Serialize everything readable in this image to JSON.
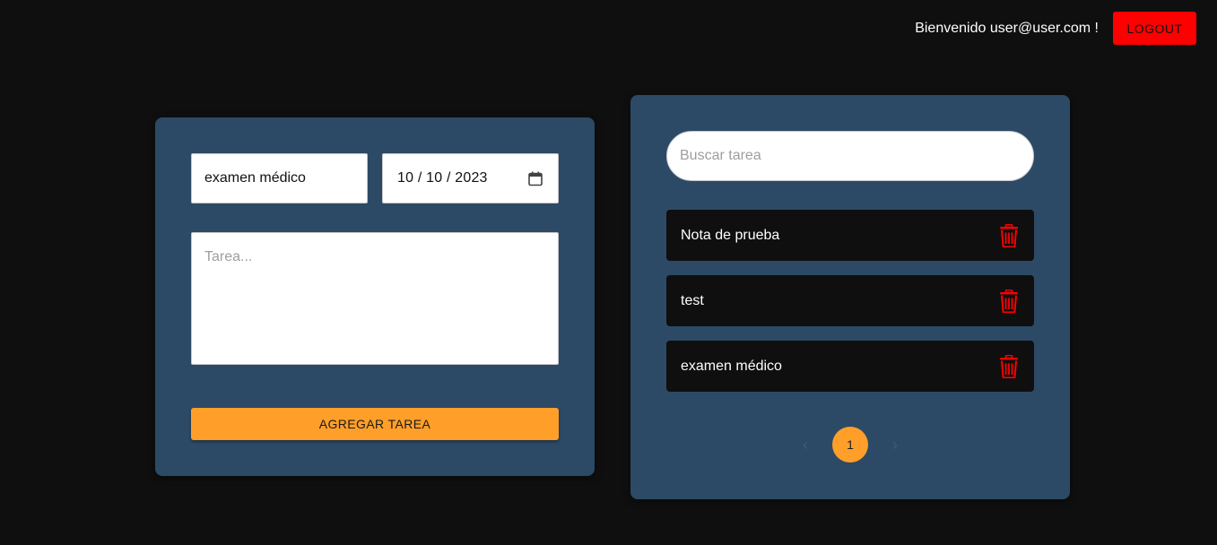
{
  "header": {
    "welcome_text": "Bienvenido user@user.com !",
    "logout_label": "LOGOUT"
  },
  "form": {
    "title_value": "examen médico",
    "date_value": "10 / 10 / 2023",
    "task_placeholder": "Tarea...",
    "add_button_label": "AGREGAR TAREA"
  },
  "list": {
    "search_placeholder": "Buscar tarea",
    "items": [
      {
        "label": "Nota de prueba"
      },
      {
        "label": "test"
      },
      {
        "label": "examen médico"
      }
    ],
    "pagination": {
      "prev_symbol": "‹",
      "current_page": "1",
      "next_symbol": "›"
    }
  },
  "colors": {
    "background": "#0f0f0f",
    "panel": "#2c4a66",
    "accent": "#ff9f2a",
    "danger": "#ff0000"
  }
}
